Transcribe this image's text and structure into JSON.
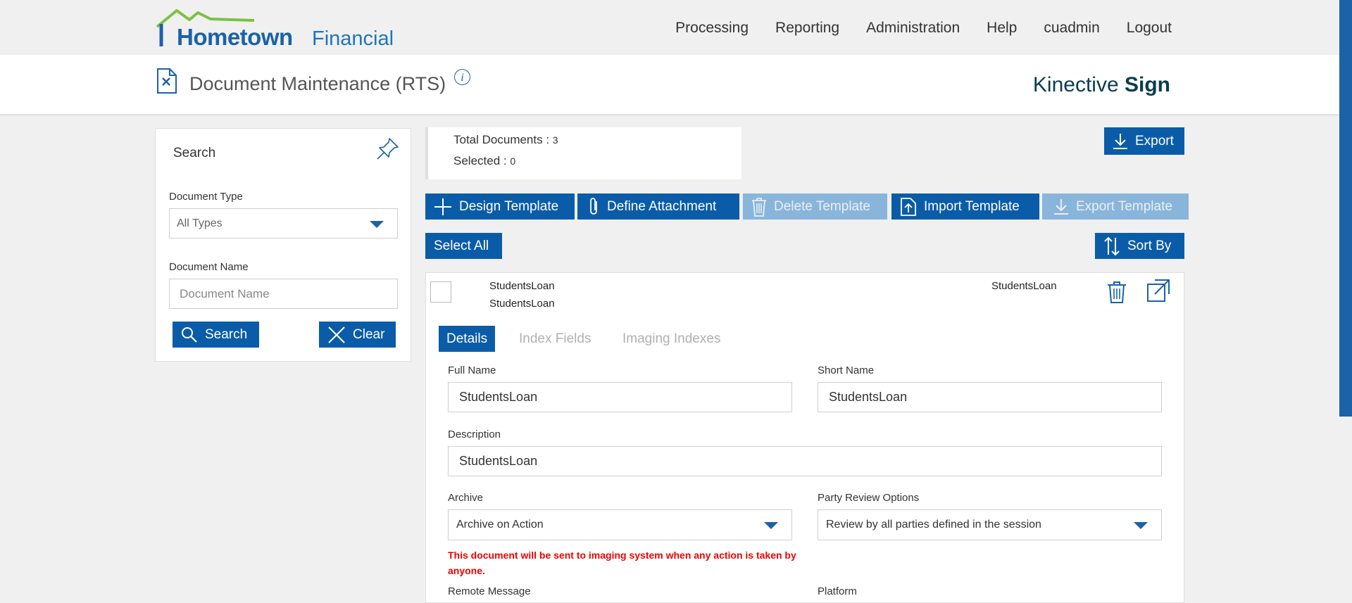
{
  "app": {
    "logo_primary": "Hometown",
    "logo_secondary": "Financial",
    "brand_light": "Kinective",
    "brand_bold": "Sign",
    "accent_color": "#0b5ca8",
    "logo_green": "#7cc142"
  },
  "nav": {
    "items": [
      "Processing",
      "Reporting",
      "Administration",
      "Help",
      "cuadmin",
      "Logout"
    ]
  },
  "header": {
    "title": "Document Maintenance (RTS)",
    "info_glyph": "i"
  },
  "search": {
    "title": "Search",
    "doc_type_label": "Document Type",
    "doc_type_value": "All Types",
    "doc_name_label": "Document Name",
    "doc_name_placeholder": "Document Name",
    "search_label": "Search",
    "clear_label": "Clear"
  },
  "counts": {
    "total_label": "Total Documents :",
    "total_value": "3",
    "selected_label": "Selected :",
    "selected_value": "0"
  },
  "toolbar": {
    "export_label": "Export",
    "design_template_label": "Design Template",
    "define_attachment_label": "Define Attachment",
    "delete_template_label": "Delete Template",
    "import_template_label": "Import Template",
    "export_template_label": "Export Template",
    "select_all_label": "Select All",
    "sort_by_label": "Sort By"
  },
  "document": {
    "name_line1": "StudentsLoan",
    "name_line2": "StudentsLoan",
    "right_name": "StudentsLoan",
    "tabs": [
      "Details",
      "Index Fields",
      "Imaging Indexes"
    ],
    "full_name_label": "Full Name",
    "full_name_value": "StudentsLoan",
    "short_name_label": "Short Name",
    "short_name_value": "StudentsLoan",
    "description_label": "Description",
    "description_value": "StudentsLoan",
    "archive_label": "Archive",
    "archive_value": "Archive on Action",
    "party_review_label": "Party Review Options",
    "party_review_value": "Review by all parties defined in the session",
    "archive_warning": "This document will be sent to imaging system when any action is taken by anyone.",
    "remote_message_label": "Remote Message",
    "platform_label": "Platform"
  }
}
